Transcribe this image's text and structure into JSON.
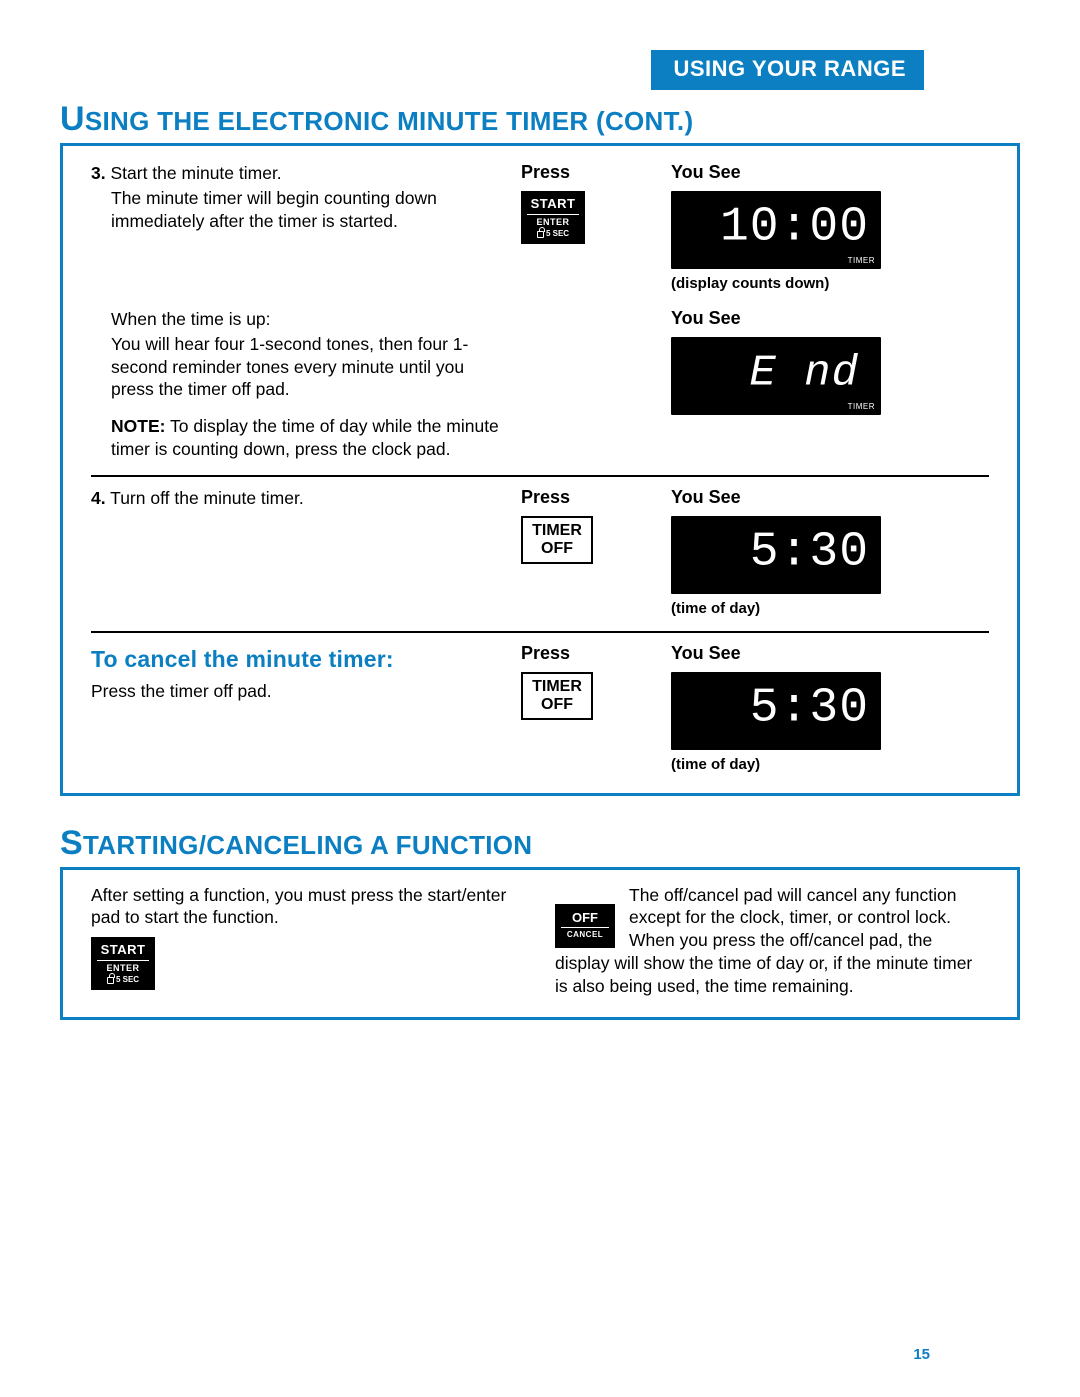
{
  "header": {
    "tab": "USING YOUR RANGE"
  },
  "section1": {
    "title_big": "U",
    "title_rest": "SING THE ELECTRONIC MINUTE TIMER (CONT.)",
    "cols": {
      "press": "Press",
      "yousee": "You See"
    },
    "step3": {
      "num": "3.",
      "lead": "Start the minute timer.",
      "body": "The minute timer will begin counting down immediately after the timer is started.",
      "display_value": "10:00",
      "display_tag": "TIMER",
      "caption": "(display counts down)"
    },
    "whenup": {
      "lead": "When the time is up:",
      "body": "You will hear four 1-second tones, then four 1-second reminder tones every minute until you press the timer off pad.",
      "note_label": "NOTE:",
      "note": "To display the time of day while the minute timer is counting down, press the clock pad.",
      "display_value": "E nd",
      "display_tag": "TIMER"
    },
    "step4": {
      "num": "4.",
      "lead": "Turn off the minute timer.",
      "display_value": "5:30",
      "caption": "(time of day)"
    },
    "cancel": {
      "heading": "To cancel the minute timer:",
      "body": "Press the timer off pad.",
      "display_value": "5:30",
      "caption": "(time of day)"
    },
    "pads": {
      "start": {
        "l1": "START",
        "l2": "ENTER",
        "l3": "5 SEC"
      },
      "timeroff": {
        "l1": "TIMER",
        "l2": "OFF"
      }
    }
  },
  "section2": {
    "title_big": "S",
    "title_rest": "TARTING/CANCELING A FUNCTION",
    "left": "After setting a function, you must press the start/enter pad to start the function.",
    "right": "The off/cancel pad will cancel any function except for the clock, timer, or control lock. When you press the off/cancel pad, the display will show the time of day or, if the minute timer is also being used, the time remaining.",
    "pads": {
      "start": {
        "l1": "START",
        "l2": "ENTER",
        "l3": "5 SEC"
      },
      "offcancel": {
        "l1": "OFF",
        "l2": "CANCEL"
      }
    }
  },
  "page_number": "15"
}
